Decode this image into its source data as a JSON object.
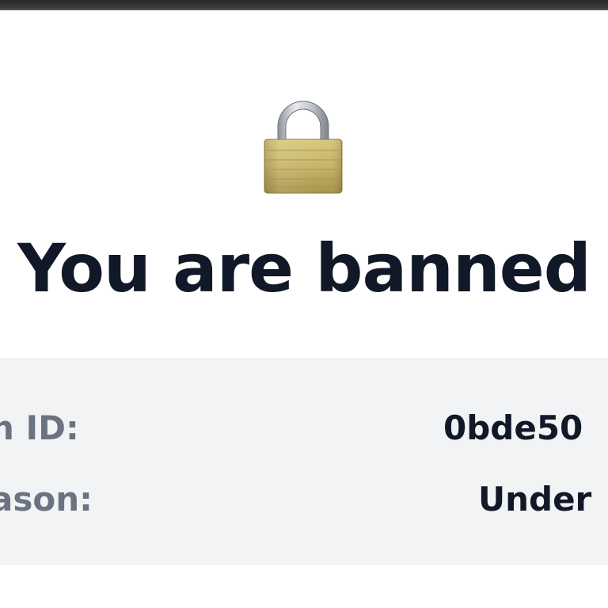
{
  "page": {
    "title": "You are banned",
    "icon": "lock-icon"
  },
  "details": {
    "ban_id_label": "n ID:",
    "ban_id_value": "0bde50",
    "reason_label": "ason:",
    "reason_value": "Under"
  },
  "colors": {
    "title": "#111827",
    "label": "#6b7280",
    "value": "#111827",
    "card_background": "#f1f3f5",
    "page_background": "#ffffff",
    "lock_body": "#c9b86a",
    "lock_shackle": "#b8bcc2"
  }
}
